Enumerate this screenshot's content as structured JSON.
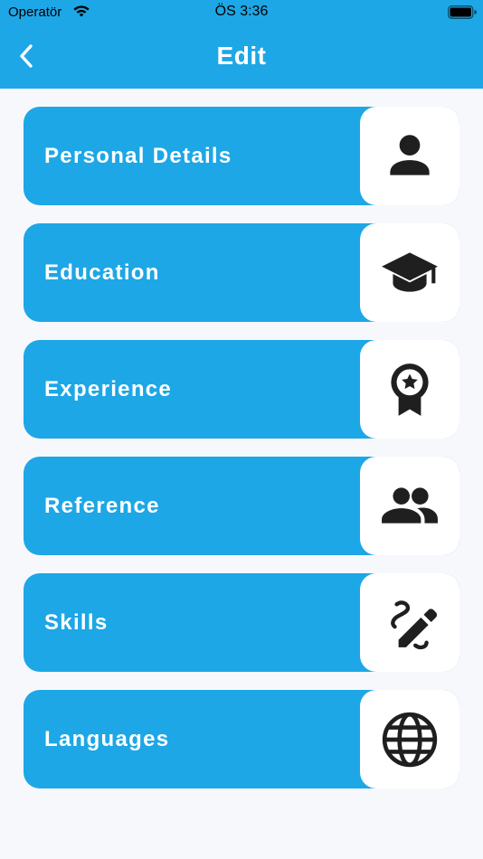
{
  "status_bar": {
    "carrier": "Operatör",
    "time": "ÖS 3:36"
  },
  "header": {
    "title": "Edit",
    "back_icon": "chevron-left-icon"
  },
  "colors": {
    "accent": "#1da7e6",
    "background": "#f7f8fc",
    "icon": "#1f1f1f"
  },
  "menu": {
    "items": [
      {
        "label": "Personal Details",
        "icon": "person-icon"
      },
      {
        "label": "Education",
        "icon": "graduation-cap-icon"
      },
      {
        "label": "Experience",
        "icon": "award-badge-icon"
      },
      {
        "label": "Reference",
        "icon": "people-icon"
      },
      {
        "label": "Skills",
        "icon": "pencil-skills-icon"
      },
      {
        "label": "Languages",
        "icon": "globe-icon"
      }
    ]
  }
}
